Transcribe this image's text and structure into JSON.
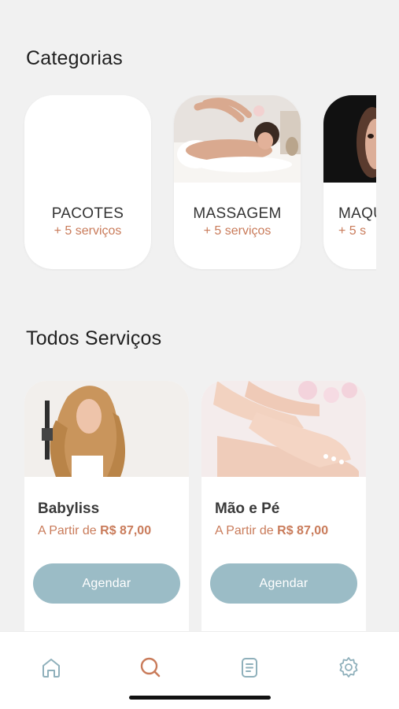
{
  "categories_section": {
    "title": "Categorias",
    "items": [
      {
        "name": "PACOTES",
        "count": "+ 5 serviços",
        "icon": "blank-image"
      },
      {
        "name": "MASSAGEM",
        "count": "+ 5 serviços",
        "icon": "massage-photo"
      },
      {
        "name": "MAQU",
        "count": "+ 5 s",
        "icon": "makeup-photo"
      }
    ]
  },
  "services_section": {
    "title": "Todos Serviços",
    "items": [
      {
        "name": "Babyliss",
        "price_prefix": "A Partir de",
        "price": "R$ 87,00",
        "button_label": "Agendar",
        "icon": "hair-photo"
      },
      {
        "name": "Mão e Pé",
        "price_prefix": "A Partir de",
        "price": "R$ 87,00",
        "button_label": "Agendar",
        "icon": "manicure-photo"
      }
    ]
  },
  "bottom_nav": {
    "items": [
      {
        "icon": "home-icon",
        "active": false
      },
      {
        "icon": "search-icon",
        "active": true
      },
      {
        "icon": "document-icon",
        "active": false
      },
      {
        "icon": "settings-icon",
        "active": false
      }
    ]
  },
  "colors": {
    "background": "#f1f1f1",
    "card": "#ffffff",
    "accent_orange": "#c97b5a",
    "button_blue": "#9bbcc6",
    "nav_icon": "#8fb0bb"
  }
}
